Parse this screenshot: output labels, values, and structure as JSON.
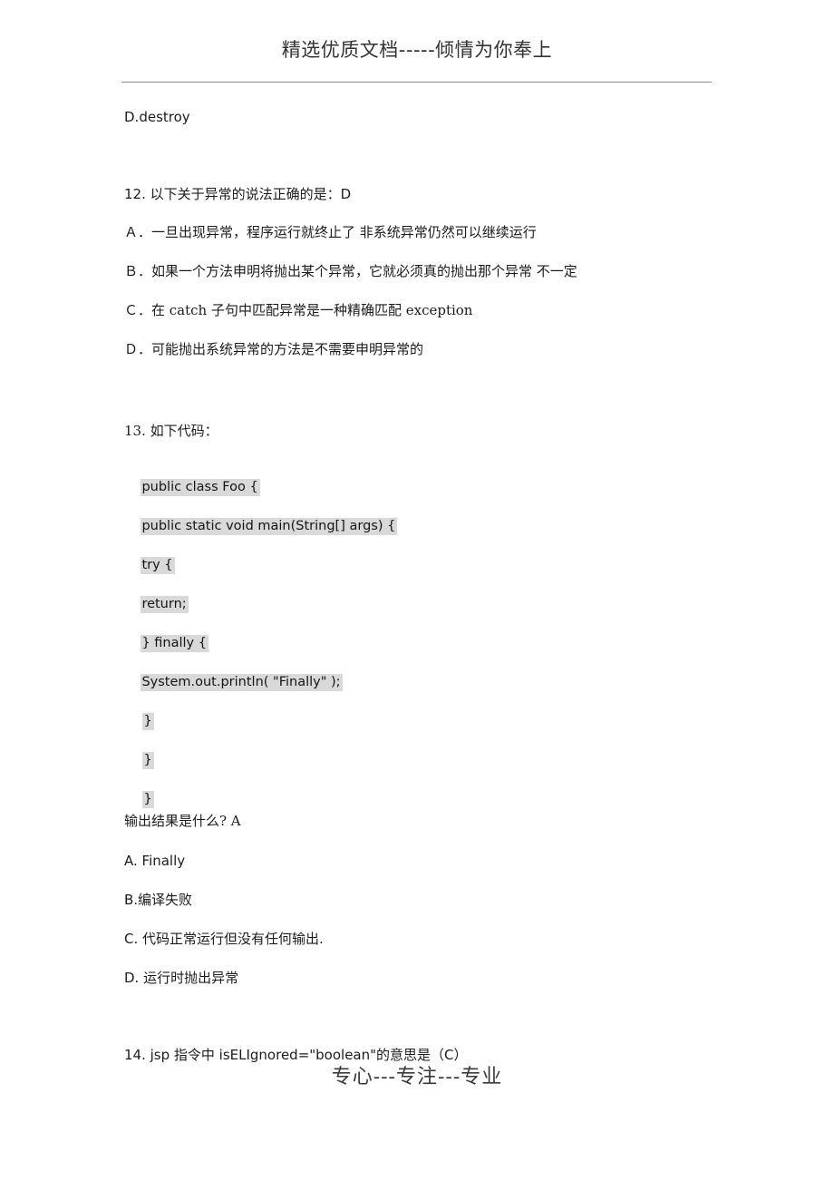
{
  "page": {
    "header_watermark": "精选优质文档-----倾情为你奉上",
    "footer_watermark": "专心---专注---专业"
  },
  "content": {
    "orphan_option": "D.destroy",
    "question12": {
      "stem": "12. 以下关于异常的说法正确的是：D",
      "options": [
        "Ａ．一旦出现异常，程序运行就终止了 非系统异常仍然可以继续运行",
        "Ｂ．如果一个方法申明将抛出某个异常，它就必须真的抛出那个异常    不一定",
        "Ｃ．在 catch 子句中匹配异常是一种精确匹配 exception",
        "Ｄ．可能抛出系统异常的方法是不需要申明异常的"
      ]
    },
    "question13": {
      "stem": "13. 如下代码：",
      "code_lines": [
        "public class Foo {",
        "public static void main(String[] args) {",
        "try {",
        "return;",
        "} finally {",
        "System.out.println( \"Finally\" );",
        "}",
        "}",
        "}"
      ],
      "prompt": "输出结果是什么?  A",
      "options": [
        "A. Finally",
        "B.编译失败",
        "C. 代码正常运行但没有任何输出.",
        "D. 运行时抛出异常"
      ]
    },
    "question14": {
      "stem": "14. jsp 指令中 isELIgnored=\"boolean\"的意思是（C）"
    }
  },
  "colors": {
    "text": "#1c1c1c",
    "rule": "#8c8c8c",
    "code_highlight": "#d9d9d9",
    "watermark": "#333333"
  }
}
